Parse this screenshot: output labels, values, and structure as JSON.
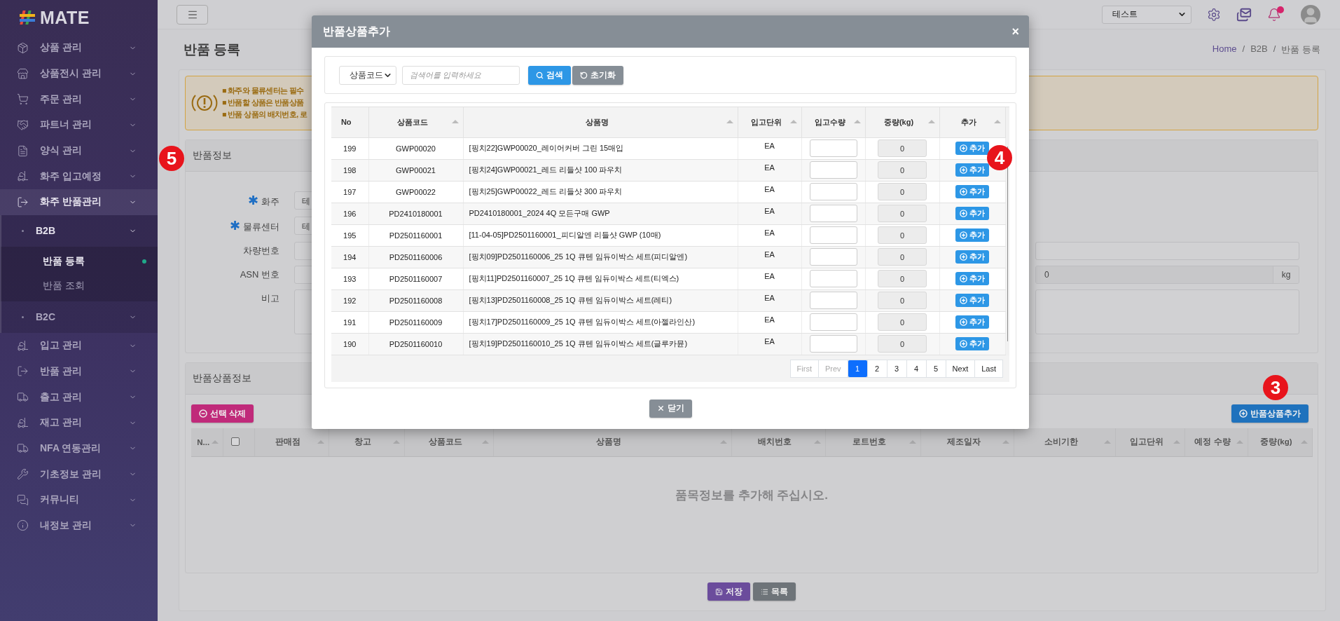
{
  "sidebar": {
    "logo": "MATE",
    "items": [
      {
        "label": "상품 관리",
        "expanded": false
      },
      {
        "label": "상품전시 관리",
        "expanded": false
      },
      {
        "label": "주문 관리",
        "expanded": false
      },
      {
        "label": "파트너 관리",
        "expanded": false
      },
      {
        "label": "양식 관리",
        "expanded": false
      },
      {
        "label": "화주 입고예정",
        "expanded": false
      },
      {
        "label": "화주 반품관리",
        "expanded": true,
        "children": [
          {
            "label": "B2B",
            "expanded": true,
            "children": [
              {
                "label": "반품 등록",
                "selected": true
              },
              {
                "label": "반품 조회",
                "selected": false
              }
            ]
          },
          {
            "label": "B2C",
            "expanded": false
          }
        ]
      },
      {
        "label": "입고 관리",
        "expanded": false
      },
      {
        "label": "반품 관리",
        "expanded": false
      },
      {
        "label": "출고 관리",
        "expanded": false
      },
      {
        "label": "재고 관리",
        "expanded": false
      },
      {
        "label": "NFA 연동관리",
        "expanded": false
      },
      {
        "label": "기초정보 관리",
        "expanded": false
      },
      {
        "label": "커뮤니티",
        "expanded": false
      },
      {
        "label": "내정보 관리",
        "expanded": false
      }
    ]
  },
  "topbar": {
    "company_select": "테스트",
    "notification_unread": true
  },
  "page": {
    "title": "반품 등록",
    "breadcrumb": [
      {
        "label": "Home",
        "kind": "link"
      },
      {
        "label": "/",
        "kind": "separator"
      },
      {
        "label": "B2B",
        "kind": "text"
      },
      {
        "label": "/",
        "kind": "separator"
      },
      {
        "label": "반품 등록",
        "kind": "text"
      }
    ]
  },
  "notice": [
    "■ 화주와 물류센터는 필수",
    "■ 반품할 상품은 반품상품",
    "■ 반품 상품의 배치번호, 로"
  ],
  "return_info": {
    "title": "반품정보",
    "required_mark": "✱",
    "fields": [
      {
        "label": "화주",
        "required": true,
        "value": "테"
      },
      {
        "label": "물류센터",
        "required": true,
        "value": "테"
      },
      {
        "label": "차량번호",
        "required": false
      },
      {
        "label": "ASN 번호",
        "required": false
      },
      {
        "label": "비고",
        "required": false
      }
    ],
    "weight_value": "0",
    "weight_unit": "kg"
  },
  "return_items": {
    "title": "반품상품정보",
    "delete_button": "선택 삭제",
    "add_button": "반품상품추가",
    "columns": [
      {
        "label": "N...",
        "kind": "text"
      },
      {
        "kind": "checkbox",
        "checked": false
      },
      {
        "label": "판매점",
        "kind": "text"
      },
      {
        "label": "창고",
        "kind": "text"
      },
      {
        "label": "상품코드",
        "kind": "text"
      },
      {
        "label": "상품명",
        "kind": "text"
      },
      {
        "label": "배치번호",
        "kind": "text"
      },
      {
        "label": "로트번호",
        "kind": "text"
      },
      {
        "label": "제조일자",
        "kind": "text"
      },
      {
        "label": "소비기한",
        "kind": "text"
      },
      {
        "label": "입고단위",
        "kind": "text"
      },
      {
        "label": "예정 수량",
        "kind": "text"
      },
      {
        "label": "중량(kg)",
        "kind": "text"
      }
    ],
    "empty_message": "품목정보를 추가해 주십시오.",
    "actions": [
      {
        "label": "저장",
        "kind": "save"
      },
      {
        "label": "목록",
        "kind": "list"
      }
    ]
  },
  "modal": {
    "title": "반품상품추가",
    "close": "×",
    "search": {
      "field": "상품코드",
      "placeholder": "검색어를 입력하세요",
      "search_button": "검색",
      "reset_button": "초기화"
    },
    "columns": [
      {
        "label": "No",
        "sortable": false
      },
      {
        "label": "상품코드",
        "sortable": true
      },
      {
        "label": "상품명",
        "sortable": true
      },
      {
        "label": "입고단위",
        "sortable": true
      },
      {
        "label": "입고수량",
        "sortable": true
      },
      {
        "label": "중량(kg)",
        "sortable": true
      },
      {
        "label": "추가",
        "sortable": true
      }
    ],
    "rows": [
      {
        "no": "199",
        "code": "GWP00020",
        "name": "[핑치22]GWP00020_레이어커버 그린 15매입",
        "unit": "EA",
        "weight": "0",
        "button": "추가"
      },
      {
        "no": "198",
        "code": "GWP00021",
        "name": "[핑치24]GWP00021_레드 리들샷 100 파우치",
        "unit": "EA",
        "weight": "0",
        "button": "추가"
      },
      {
        "no": "197",
        "code": "GWP00022",
        "name": "[핑치25]GWP00022_레드 리들샷 300 파우치",
        "unit": "EA",
        "weight": "0",
        "button": "추가"
      },
      {
        "no": "196",
        "code": "PD2410180001",
        "name": "PD2410180001_2024 4Q 모든구매 GWP",
        "unit": "EA",
        "weight": "0",
        "button": "추가"
      },
      {
        "no": "195",
        "code": "PD2501160001",
        "name": "[11-04-05]PD2501160001_피디알엔 리들샷 GWP (10매)",
        "unit": "EA",
        "weight": "0",
        "button": "추가"
      },
      {
        "no": "194",
        "code": "PD2501160006",
        "name": "[핑치09]PD2501160006_25 1Q 큐텐 임듀이박스 세트(피디알엔)",
        "unit": "EA",
        "weight": "0",
        "button": "추가"
      },
      {
        "no": "193",
        "code": "PD2501160007",
        "name": "[핑치11]PD2501160007_25 1Q 큐텐 임듀이박스 세트(티엑스)",
        "unit": "EA",
        "weight": "0",
        "button": "추가"
      },
      {
        "no": "192",
        "code": "PD2501160008",
        "name": "[핑치13]PD2501160008_25 1Q 큐텐 임듀이박스 세트(레티)",
        "unit": "EA",
        "weight": "0",
        "button": "추가"
      },
      {
        "no": "191",
        "code": "PD2501160009",
        "name": "[핑치17]PD2501160009_25 1Q 큐텐 임듀이박스 세트(아젤라인산)",
        "unit": "EA",
        "weight": "0",
        "button": "추가"
      },
      {
        "no": "190",
        "code": "PD2501160010",
        "name": "[핑치19]PD2501160010_25 1Q 큐텐 임듀이박스 세트(글루카뮨)",
        "unit": "EA",
        "weight": "0",
        "button": "추가"
      }
    ],
    "pagination": [
      {
        "label": "First",
        "disabled": true,
        "selected": false
      },
      {
        "label": "Prev",
        "disabled": true,
        "selected": false
      },
      {
        "label": "1",
        "disabled": false,
        "selected": true
      },
      {
        "label": "2",
        "disabled": false,
        "selected": false
      },
      {
        "label": "3",
        "disabled": false,
        "selected": false
      },
      {
        "label": "4",
        "disabled": false,
        "selected": false
      },
      {
        "label": "5",
        "disabled": false,
        "selected": false
      },
      {
        "label": "Next",
        "disabled": false,
        "selected": false
      },
      {
        "label": "Last",
        "disabled": false,
        "selected": false
      }
    ],
    "close_button": "닫기"
  },
  "markers": [
    {
      "label": "5"
    },
    {
      "label": "4"
    },
    {
      "label": "3"
    }
  ]
}
